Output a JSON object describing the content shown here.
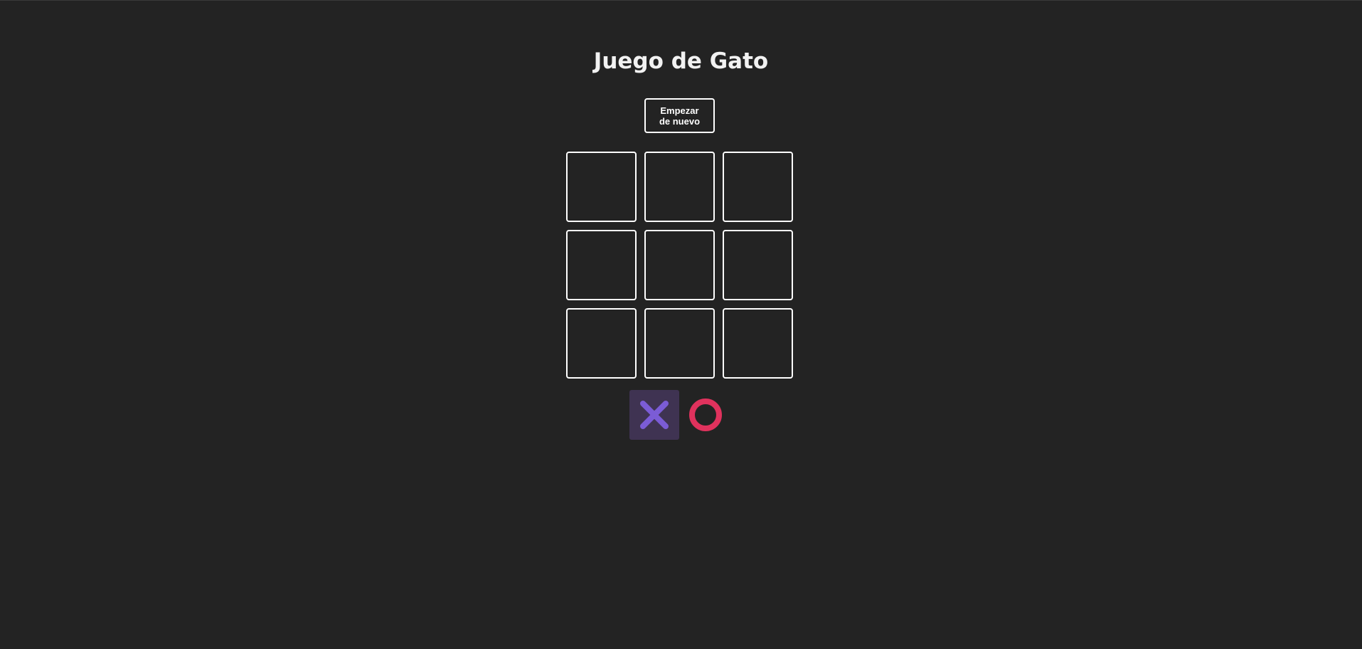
{
  "game": {
    "title": "Juego de Gato",
    "reset_label": "Empezar de nuevo",
    "board": [
      "",
      "",
      "",
      "",
      "",
      "",
      "",
      "",
      ""
    ],
    "current_turn": "X"
  },
  "turn_indicator": {
    "x_icon": "x-mark-icon",
    "o_icon": "o-circle-icon"
  },
  "colors": {
    "background": "#232323",
    "x_color": "#7b5cd6",
    "o_color": "#e0325d",
    "active_turn_bg": "#3f3352",
    "border": "#ffffff"
  }
}
